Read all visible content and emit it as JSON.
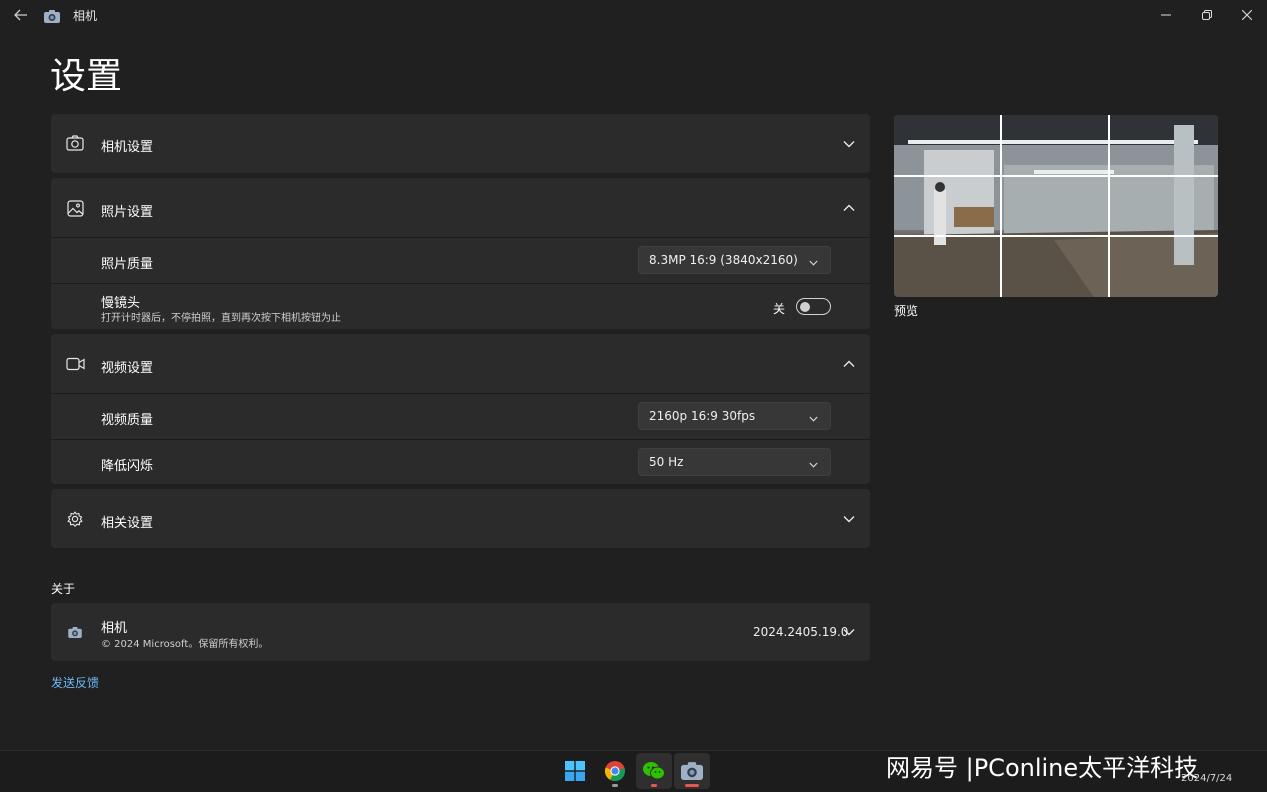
{
  "window": {
    "title": "相机",
    "controls": {
      "minimize": "—",
      "restore": "❐",
      "close": "✕"
    }
  },
  "page": {
    "title": "设置"
  },
  "sections": {
    "camera": {
      "label": "相机设置"
    },
    "photo": {
      "label": "照片设置",
      "quality_label": "照片质量",
      "quality_value": "8.3MP 16:9 (3840x2160)",
      "burst_label": "慢镜头",
      "burst_desc": "打开计时器后，不停拍照，直到再次按下相机按钮为止",
      "burst_toggle_text": "关",
      "burst_on": false
    },
    "video": {
      "label": "视频设置",
      "quality_label": "视频质量",
      "quality_value": "2160p 16:9 30fps",
      "flicker_label": "降低闪烁",
      "flicker_value": "50 Hz"
    },
    "related": {
      "label": "相关设置"
    }
  },
  "preview": {
    "label": "预览"
  },
  "about": {
    "label": "关于",
    "app_name": "相机",
    "copyright": "© 2024 Microsoft。保留所有权利。",
    "version": "2024.2405.19.0"
  },
  "feedback": {
    "label": "发送反馈"
  },
  "taskbar": {
    "watermark": "网易号 |PConline太平洋科技",
    "date": "2024/7/24"
  },
  "colors": {
    "background": "#202020",
    "card": "#2b2b2b",
    "link": "#6cb8f6",
    "chrome_dot": "#9a9a9a",
    "camera_dot": "#e05a4f"
  }
}
